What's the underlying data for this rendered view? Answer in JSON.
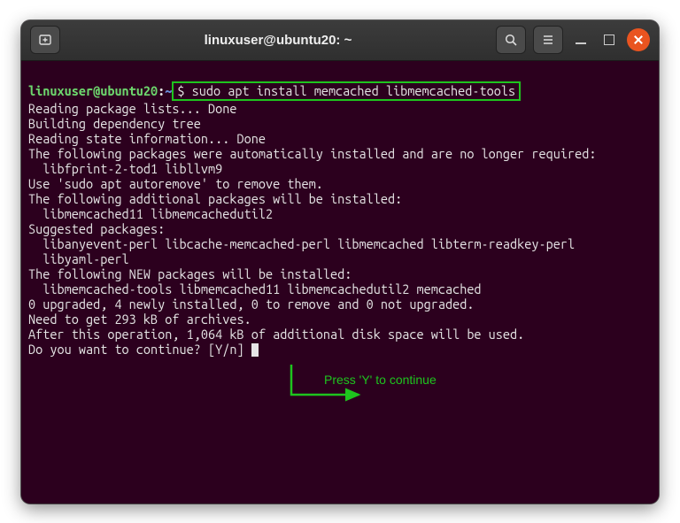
{
  "window": {
    "title": "linuxuser@ubuntu20: ~"
  },
  "prompt": {
    "user_host": "linuxuser@ubuntu20",
    "separator": ":",
    "path": "~",
    "command": "$ sudo apt install memcached libmemcached-tools"
  },
  "output_lines": [
    "Reading package lists... Done",
    "Building dependency tree",
    "Reading state information... Done",
    "The following packages were automatically installed and are no longer required:",
    "  libfprint-2-tod1 libllvm9",
    "Use 'sudo apt autoremove' to remove them.",
    "The following additional packages will be installed:",
    "  libmemcached11 libmemcachedutil2",
    "Suggested packages:",
    "  libanyevent-perl libcache-memcached-perl libmemcached libterm-readkey-perl",
    "  libyaml-perl",
    "The following NEW packages will be installed:",
    "  libmemcached-tools libmemcached11 libmemcachedutil2 memcached",
    "0 upgraded, 4 newly installed, 0 to remove and 0 not upgraded.",
    "Need to get 293 kB of archives.",
    "After this operation, 1,064 kB of additional disk space will be used.",
    "Do you want to continue? [Y/n] "
  ],
  "annotation": {
    "label": "Press 'Y' to continue"
  },
  "colors": {
    "terminal_bg": "#2c001e",
    "prompt_user": "#6dd66d",
    "prompt_path": "#6a8bd6",
    "text": "#e6e6e6",
    "highlight_green": "#1ec41e",
    "close_orange": "#e95420"
  }
}
